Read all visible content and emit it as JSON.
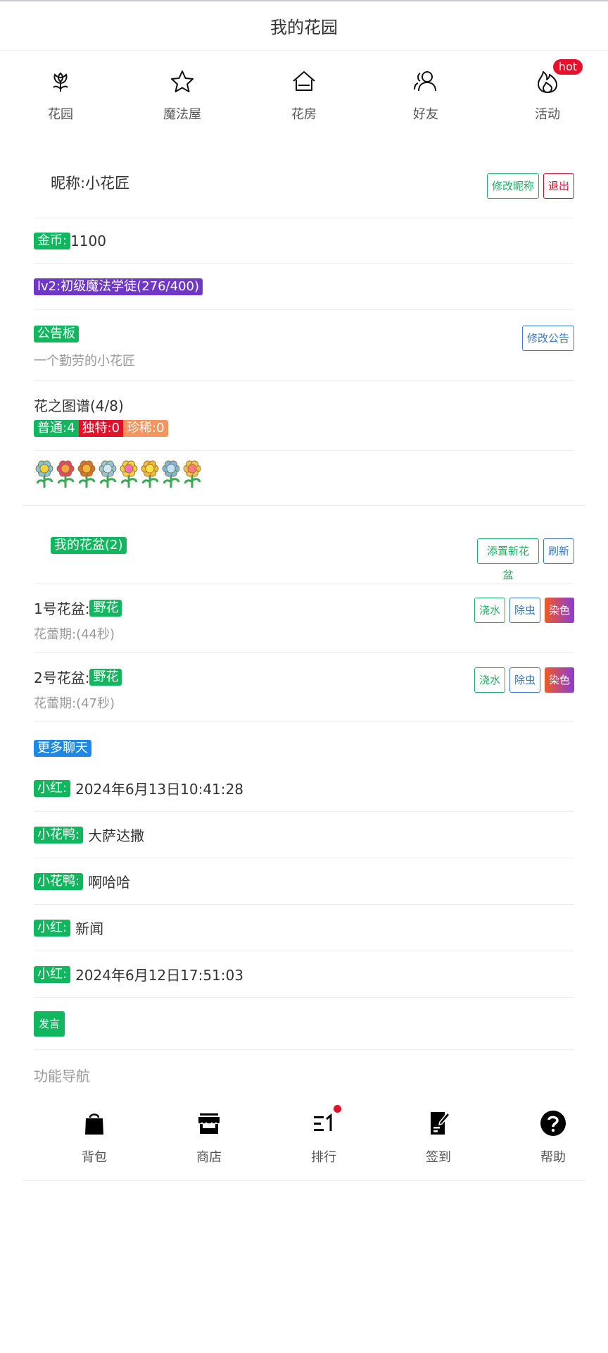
{
  "header": {
    "title": "我的花园"
  },
  "topnav": [
    {
      "label": "花园",
      "icon": "flower-icon"
    },
    {
      "label": "魔法屋",
      "icon": "star-icon"
    },
    {
      "label": "花房",
      "icon": "house-icon"
    },
    {
      "label": "好友",
      "icon": "friends-icon"
    },
    {
      "label": "活动",
      "icon": "fire-icon",
      "badge": "hot"
    }
  ],
  "profile": {
    "nickname": "昵称:小花匠",
    "edit_nickname_label": "修改昵称",
    "logout_label": "退出",
    "gold_label": "金币:",
    "gold_value": "1100",
    "level": "lv2:初级魔法学徒(276/400)",
    "bulletin_label": "公告板",
    "bulletin_text": "一个勤劳的小花匠",
    "edit_bulletin_label": "修改公告"
  },
  "atlas": {
    "title": "花之图谱(4/8)",
    "normal": "普通:4",
    "unique": "独特:0",
    "rare": "珍稀:0",
    "flower_count": 8
  },
  "pots": {
    "header_label": "我的花盆(2)",
    "add_label": "添置新花盆",
    "refresh_label": "刷新",
    "water_label": "浇水",
    "bug_label": "除虫",
    "dye_label": "染色",
    "items": [
      {
        "name": "1号花盆:",
        "type": "野花",
        "stage": "花蕾期:(44秒)"
      },
      {
        "name": "2号花盆:",
        "type": "野花",
        "stage": "花蕾期:(47秒)"
      }
    ]
  },
  "chat": {
    "more_label": "更多聊天",
    "messages": [
      {
        "user": "小红:",
        "text": "2024年6月13日10:41:28"
      },
      {
        "user": "小花鸭:",
        "text": "大萨达撒"
      },
      {
        "user": "小花鸭:",
        "text": "啊哈哈"
      },
      {
        "user": "小红:",
        "text": "新闻"
      },
      {
        "user": "小红:",
        "text": "2024年6月12日17:51:03"
      }
    ],
    "post_label": "发言"
  },
  "function_nav": {
    "title": "功能导航",
    "items": [
      {
        "label": "背包",
        "icon": "bag-icon"
      },
      {
        "label": "商店",
        "icon": "store-icon"
      },
      {
        "label": "排行",
        "icon": "ranking-icon",
        "has_dot": true
      },
      {
        "label": "签到",
        "icon": "checkin-icon"
      },
      {
        "label": "帮助",
        "icon": "help-icon"
      }
    ]
  },
  "colors": {
    "green_tag": "#11b75f",
    "purple_tag": "#6f37c8",
    "red_tag": "#e3102a",
    "orange_tag": "#f5945c",
    "blue_tag": "#1e88e5"
  }
}
